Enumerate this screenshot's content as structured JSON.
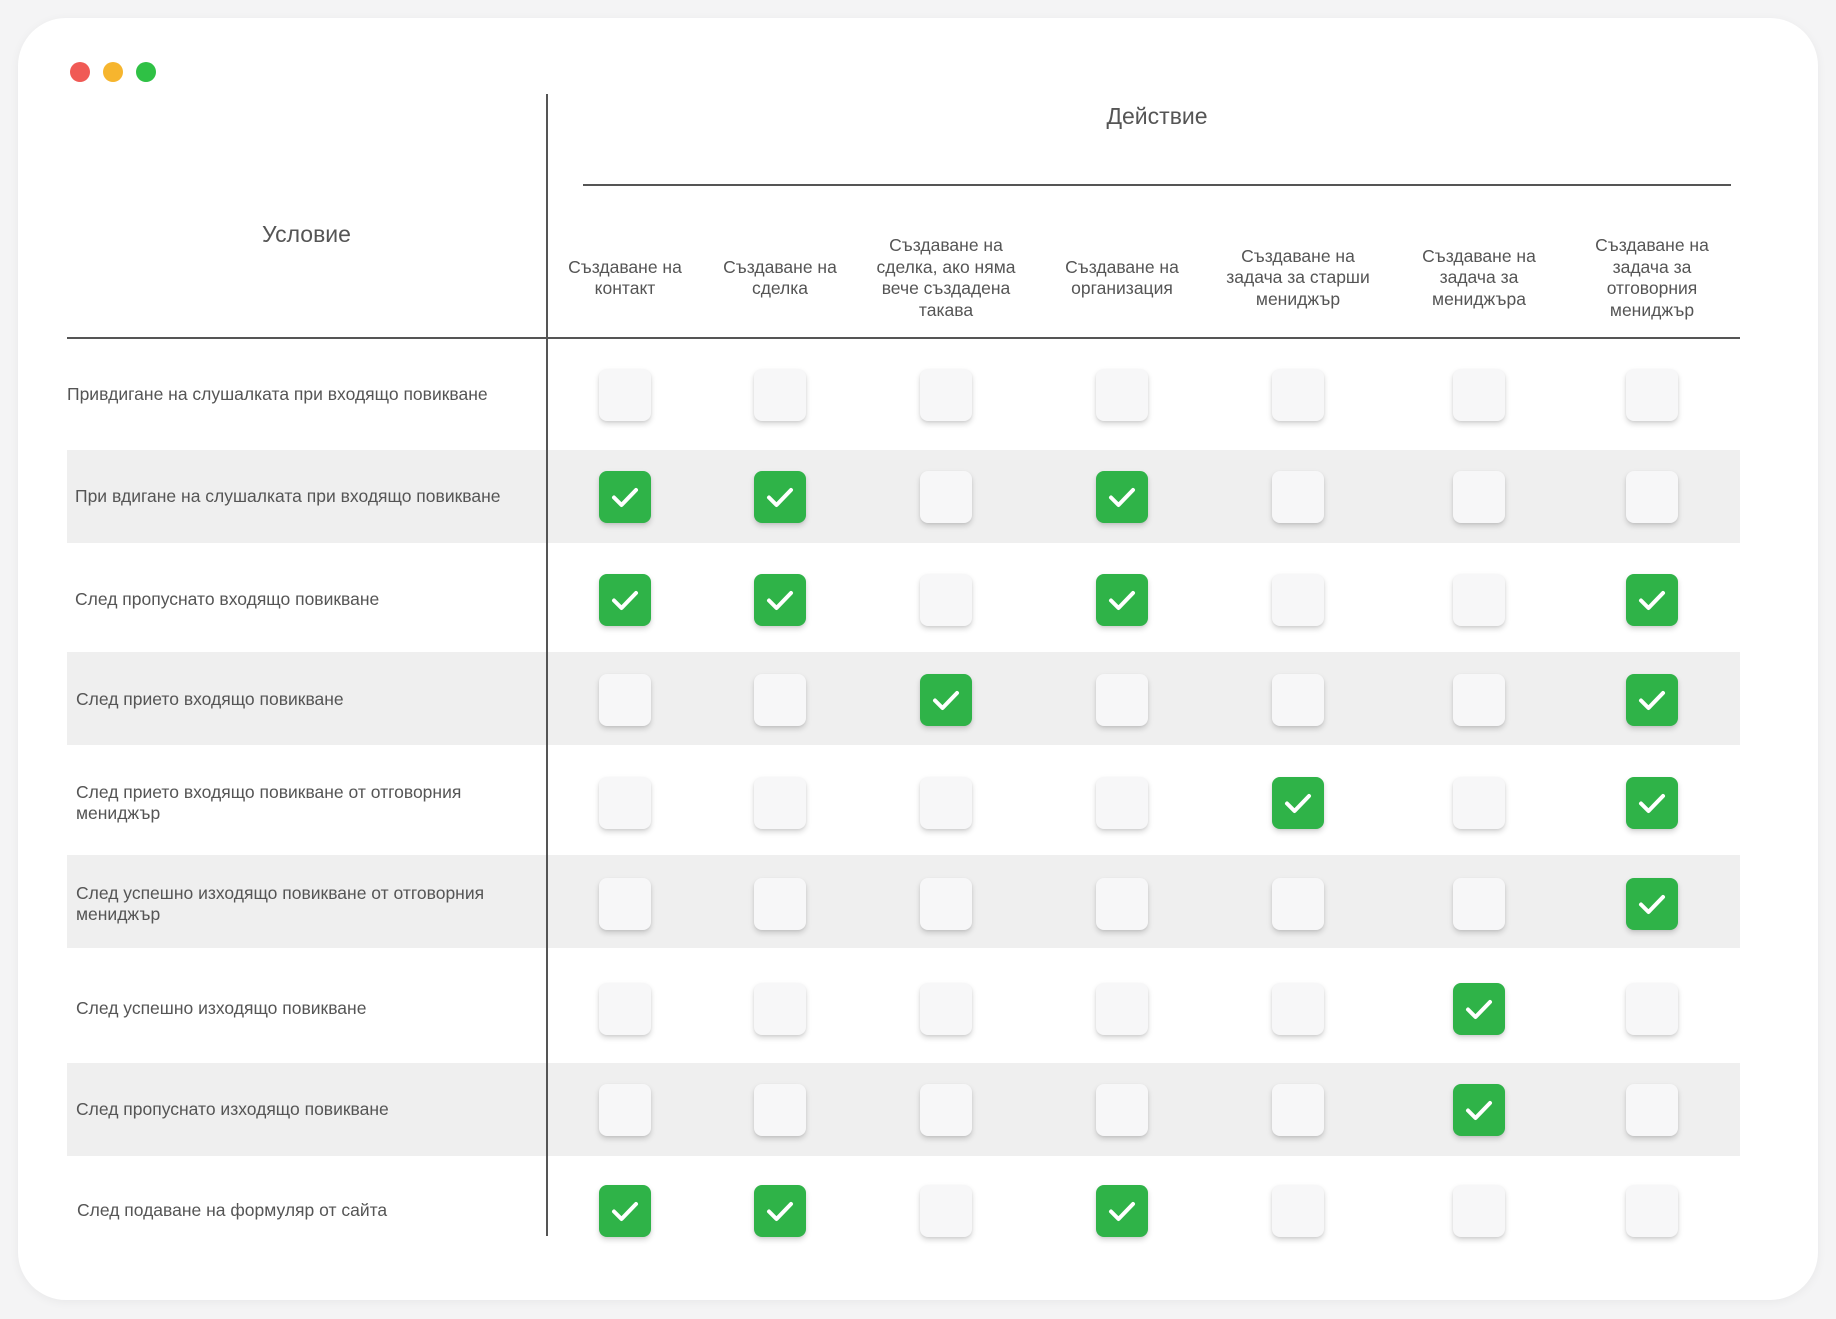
{
  "window": {
    "controls": [
      "close",
      "minimize",
      "maximize"
    ]
  },
  "table": {
    "condition_title": "Условие",
    "action_title": "Действие",
    "columns": [
      "Създаване на контакт",
      "Създаване на сделка",
      "Създаване на сделка, ако няма вече създадена такава",
      "Създаване на организация",
      "Създаване на задача за старши мениджър",
      "Създаване на задача за мениджъра",
      "Създаване на задача за отговорния мениджър"
    ],
    "rows": [
      {
        "label": "Привдигане на слушалката при входящо повикване",
        "checks": [
          false,
          false,
          false,
          false,
          false,
          false,
          false
        ]
      },
      {
        "label": "При вдигане на слушалката при входящо повикване",
        "checks": [
          true,
          true,
          false,
          true,
          false,
          false,
          false
        ]
      },
      {
        "label": "След пропуснато входящо повикване",
        "checks": [
          true,
          true,
          false,
          true,
          false,
          false,
          true
        ]
      },
      {
        "label": "След прието входящо повикване",
        "checks": [
          false,
          false,
          true,
          false,
          false,
          false,
          true
        ]
      },
      {
        "label": "След прието входящо повикване от отговорния мениджър",
        "checks": [
          false,
          false,
          false,
          false,
          true,
          false,
          true
        ]
      },
      {
        "label": "След успешно изходящо повикване от отговорния мениджър",
        "checks": [
          false,
          false,
          false,
          false,
          false,
          false,
          true
        ]
      },
      {
        "label": "След успешно изходящо повикване",
        "checks": [
          false,
          false,
          false,
          false,
          false,
          true,
          false
        ]
      },
      {
        "label": "След пропуснато изходящо повикване",
        "checks": [
          false,
          false,
          false,
          false,
          false,
          true,
          false
        ]
      },
      {
        "label": "След подаване на формуляр от сайта",
        "checks": [
          true,
          true,
          false,
          true,
          false,
          false,
          false
        ]
      }
    ]
  },
  "colors": {
    "checked": "#2fb348",
    "unchecked": "#f7f7f8",
    "band": "#efefef",
    "text": "#555555"
  }
}
